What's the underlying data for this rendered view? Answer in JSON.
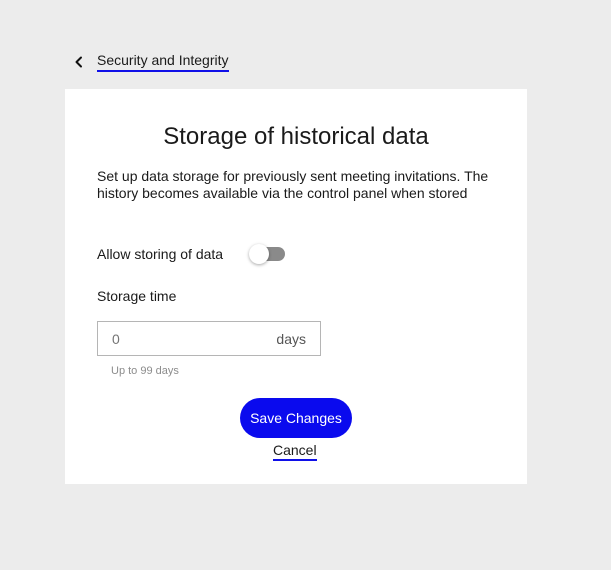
{
  "breadcrumb": {
    "label": "Security and Integrity"
  },
  "card": {
    "title": "Storage of historical data",
    "description": "Set up data storage for previously sent meeting invitations. The history becomes available via the control panel when stored",
    "toggle": {
      "label": "Allow storing of data",
      "enabled": false
    },
    "storage_time": {
      "label": "Storage time",
      "value": "",
      "placeholder": "0",
      "suffix": "days",
      "hint": "Up to 99 days"
    },
    "save_label": "Save Changes",
    "cancel_label": "Cancel"
  },
  "colors": {
    "background": "#ececec",
    "card": "#ffffff",
    "accent": "#0a0aee",
    "toggle_off": "#8a8a8a"
  },
  "icons": {
    "back": "chevron-left-icon"
  }
}
